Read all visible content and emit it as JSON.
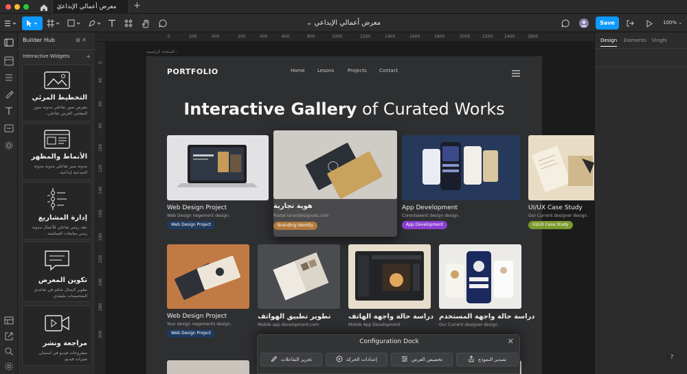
{
  "titlebar": {
    "tab_title": "معرض أعمالي الإبداعي",
    "tab_close": "×",
    "new_tab": "+"
  },
  "toolbar": {
    "file_name": "معرض أعمالي الإبداعي ⌄",
    "save_label": "Save",
    "zoom": "100% ⌄"
  },
  "left_panel": {
    "title": "Builder Hub",
    "controls": "⊞ ✕",
    "section": "Interactive Widgets",
    "section_add": "+",
    "widgets": [
      {
        "title": "التخطيط المرئي",
        "desc": "معرض صور تفاعلي مدونة صور المعامي العرض تفاعلي.",
        "icon": "image-layout-icon"
      },
      {
        "title": "الأنماط والمظهر",
        "desc": "مدونة صير تفاعلي مدونة مدونة المبدعية إبداعية.",
        "icon": "layout-style-icon"
      },
      {
        "title": "إدارة المشاريع",
        "desc": "عقد زمني تفاعلي للأعمال مدونة زمني متابعات العماشية.",
        "icon": "timeline-icon"
      },
      {
        "title": "تكوين المعرض",
        "desc": "تطوير لايضال تحكم في تفاعدي المتحسمات مليفدي.",
        "icon": "chat-bubble-icon"
      },
      {
        "title": "مراجعة ونشر",
        "desc": "مشروعات فيديو في استمان شيرات فيديو.",
        "icon": "video-icon"
      }
    ]
  },
  "rulers": {
    "h_ticks": [
      "0",
      "200",
      "400",
      "200",
      "400",
      "600",
      "800",
      "1000",
      "1200",
      "1400",
      "1600",
      "1800",
      "2000",
      "2200",
      "2400",
      "2800"
    ],
    "v_ticks": [
      "0",
      "40",
      "60",
      "80",
      "100",
      "120",
      "140",
      "160",
      "180",
      "200",
      "240",
      "280",
      "300"
    ]
  },
  "artboard": {
    "frame_label": "- الصفحة الرئيسية",
    "logo": "PORTFOLIO",
    "nav": [
      "Home",
      "Lesons",
      "Projects",
      "Contact"
    ],
    "hero_bold": "Interactive Gallery",
    "hero_rest": " of Curated Works",
    "cards": [
      {
        "title": "Web Design Project",
        "sub": "Web Design negement design.",
        "badge": "Web Design Project",
        "badge_color": "#1f3a5f"
      },
      {
        "title": "هوية تجارية",
        "sub": "Postal laranidesignots.com",
        "badge": "Branding Identity",
        "badge_color": "#b07a3c"
      },
      {
        "title": "App Development",
        "sub": "Corentawent design design.",
        "badge": "App Development",
        "badge_color": "#8a3fd1"
      },
      {
        "title": "UI/UX Case Study",
        "sub": "Our Current designer design.",
        "badge": "UI/UX Case Study",
        "badge_color": "#7a9a2e"
      },
      {
        "title": "Web Design Project",
        "sub": "Your design negements design.",
        "badge": "Web Design Project",
        "badge_color": "#1f3a5f"
      },
      {
        "title": "تطوير تطبيق الهواتف",
        "sub": "Mobile app development.com",
        "badge": "",
        "badge_color": ""
      },
      {
        "title": "دراسة حالة واجهة الهاتف",
        "sub": "Mobile App Development",
        "badge": "",
        "badge_color": ""
      },
      {
        "title": "دراسة حالة واجهة المستخدم",
        "sub": "Our Current designer design.",
        "badge": "",
        "badge_color": ""
      }
    ]
  },
  "right_panel": {
    "tabs": [
      "Design",
      "Elements",
      "Vinghl"
    ]
  },
  "dock": {
    "title": "Configuration Dock",
    "close": "✕",
    "buttons": [
      {
        "label": "تحرير التفاعلات",
        "icon": "pencil-icon"
      },
      {
        "label": "إعدادات الحركة",
        "icon": "motion-icon"
      },
      {
        "label": "تخصيص العرض",
        "icon": "sliders-icon"
      },
      {
        "label": "تصدير النموذج",
        "icon": "export-icon"
      }
    ]
  },
  "help": "?"
}
